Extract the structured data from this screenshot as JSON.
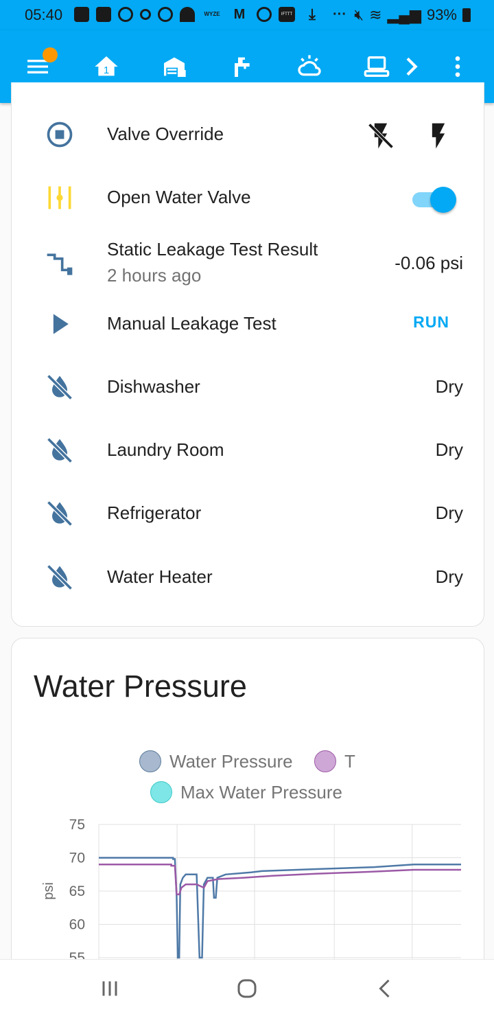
{
  "status_bar": {
    "time": "05:40",
    "battery": "93%",
    "icons_left": [
      "youtube-icon",
      "b-icon",
      "circle-icon",
      "gear-icon",
      "q-icon",
      "weather-icon",
      "wyze-icon",
      "gmail-icon",
      "play-icon",
      "ifttt-icon",
      "download-icon",
      "more-icon"
    ],
    "wyze_text": "WYZE",
    "ifttt_text": "IFTTT",
    "icons_right": [
      "mute-icon",
      "wifi-icon",
      "signal-icon",
      "battery-icon"
    ]
  },
  "app_bar": {
    "tabs": [
      "home-icon",
      "garage-icon",
      "faucet-icon",
      "weather-icon",
      "laptop-icon"
    ],
    "accent": "#03a9f4"
  },
  "controls": {
    "valve_override": {
      "label": "Valve Override"
    },
    "open_valve": {
      "label": "Open Water Valve",
      "state": "on"
    },
    "static_leak": {
      "label": "Static Leakage Test Result",
      "sub": "2 hours ago",
      "value": "-0.06 psi"
    },
    "manual_leak": {
      "label": "Manual Leakage Test",
      "action": "RUN"
    },
    "sensors": [
      {
        "label": "Dishwasher",
        "value": "Dry"
      },
      {
        "label": "Laundry Room",
        "value": "Dry"
      },
      {
        "label": "Refrigerator",
        "value": "Dry"
      },
      {
        "label": "Water Heater",
        "value": "Dry"
      }
    ]
  },
  "pressure_card": {
    "title": "Water Pressure",
    "legend": [
      {
        "label": "Water Pressure",
        "color": "#a7b8cf",
        "border": "#5c7b99"
      },
      {
        "label": "T",
        "color": "#cfa7d6",
        "border": "#9c5aa6"
      },
      {
        "label": "Max Water Pressure",
        "color": "#7ee6e6",
        "border": "#3cc8c8"
      }
    ]
  },
  "chart_data": {
    "type": "line",
    "ylabel": "psi",
    "ylim": [
      55,
      75
    ],
    "yticks": [
      55,
      60,
      65,
      70,
      75
    ],
    "grid": true,
    "series": [
      {
        "name": "Water Pressure",
        "color": "#4e79a7",
        "values": [
          [
            0,
            70
          ],
          [
            0.205,
            70
          ],
          [
            0.205,
            69.8
          ],
          [
            0.21,
            69.8
          ],
          [
            0.215,
            64
          ],
          [
            0.218,
            55
          ],
          [
            0.222,
            55
          ],
          [
            0.225,
            66
          ],
          [
            0.232,
            67
          ],
          [
            0.24,
            67.5
          ],
          [
            0.27,
            67.5
          ],
          [
            0.278,
            55
          ],
          [
            0.285,
            55
          ],
          [
            0.29,
            66
          ],
          [
            0.3,
            67
          ],
          [
            0.315,
            67
          ],
          [
            0.318,
            64
          ],
          [
            0.323,
            64
          ],
          [
            0.327,
            67
          ],
          [
            0.35,
            67.5
          ],
          [
            0.42,
            67.8
          ],
          [
            0.45,
            68
          ],
          [
            0.6,
            68.3
          ],
          [
            0.76,
            68.6
          ],
          [
            0.87,
            69
          ],
          [
            1.0,
            69
          ]
        ]
      },
      {
        "name": "T",
        "color": "#9b59a6",
        "values": [
          [
            0,
            69
          ],
          [
            0.2,
            69
          ],
          [
            0.2,
            68.8
          ],
          [
            0.21,
            68.8
          ],
          [
            0.215,
            64.5
          ],
          [
            0.222,
            64.5
          ],
          [
            0.228,
            65.5
          ],
          [
            0.24,
            66
          ],
          [
            0.27,
            66
          ],
          [
            0.29,
            65.5
          ],
          [
            0.3,
            66.5
          ],
          [
            0.33,
            66.8
          ],
          [
            0.4,
            67
          ],
          [
            0.48,
            67.3
          ],
          [
            0.6,
            67.6
          ],
          [
            0.75,
            67.9
          ],
          [
            0.87,
            68.2
          ],
          [
            1.0,
            68.2
          ]
        ]
      }
    ]
  },
  "nav": {
    "buttons": [
      "recents-icon",
      "home-button-icon",
      "back-icon"
    ]
  }
}
